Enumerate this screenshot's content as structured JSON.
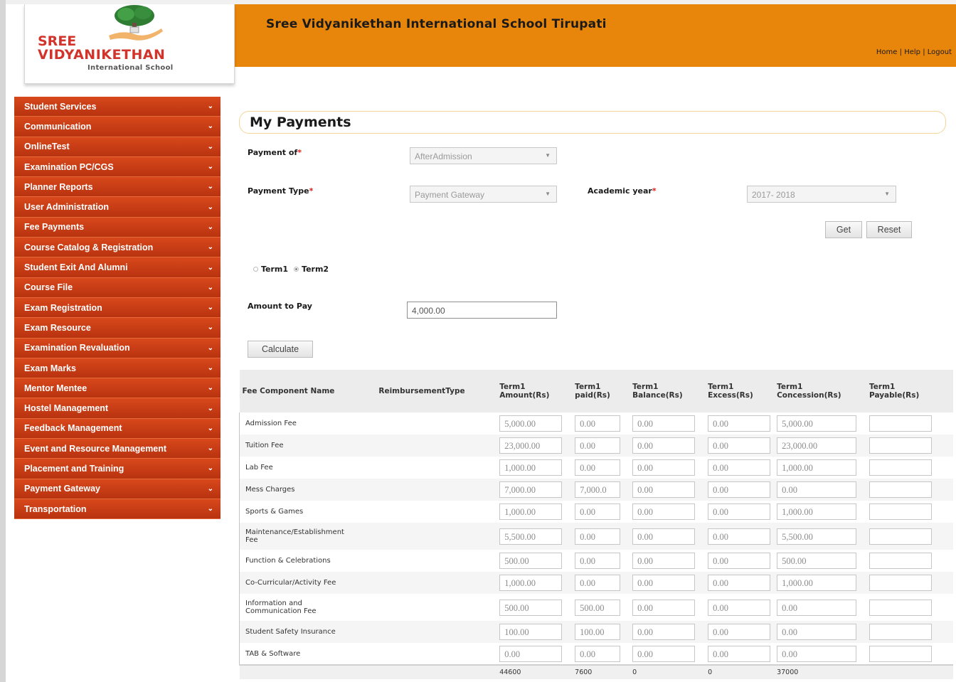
{
  "header": {
    "site_title": "Sree Vidyanikethan International School Tirupati",
    "links": [
      "Home",
      "Help",
      "Logout"
    ]
  },
  "logo": {
    "line1": "SREE",
    "line2": "VIDYANIKETHAN",
    "line3": "International School"
  },
  "sidebar": {
    "items": [
      "Student Services",
      "Communication",
      "OnlineTest",
      "Examination PC/CGS",
      "Planner Reports",
      "User Administration",
      "Fee Payments",
      "Course Catalog & Registration",
      "Student Exit And Alumni",
      "Course File",
      "Exam Registration",
      "Exam Resource",
      "Examination Revaluation",
      "Exam Marks",
      "Mentor Mentee",
      "Hostel Management",
      "Feedback Management",
      "Event and Resource Management",
      "Placement and Training",
      "Payment Gateway",
      "Transportation"
    ]
  },
  "page": {
    "title": "My Payments"
  },
  "form": {
    "payment_of_label": "Payment of",
    "payment_of_value": "AfterAdmission",
    "payment_type_label": "Payment Type",
    "payment_type_value": "Payment Gateway",
    "academic_year_label": "Academic year",
    "academic_year_value": "2017- 2018",
    "get_label": "Get",
    "reset_label": "Reset",
    "term1_label": "Term1",
    "term2_label": "Term2",
    "selected_term": "Term2",
    "amount_label": "Amount to Pay",
    "amount_value": "4,000.00",
    "calculate_label": "Calculate",
    "required_mark": "*"
  },
  "table": {
    "headers": [
      [
        "Fee Component Name"
      ],
      [
        "ReimbursementType"
      ],
      [
        "Term1",
        "Amount(Rs)"
      ],
      [
        "Term1",
        "paid(Rs)"
      ],
      [
        "Term1",
        "Balance(Rs)"
      ],
      [
        "Term1",
        "Excess(Rs)"
      ],
      [
        "Term1",
        "Concession(Rs)"
      ],
      [
        "Term1",
        "Payable(Rs)"
      ]
    ],
    "rows": [
      {
        "name": [
          "Admission Fee"
        ],
        "amount": "5,000.00",
        "paid": "0.00",
        "balance": "0.00",
        "excess": "0.00",
        "concession": "5,000.00",
        "payable": ""
      },
      {
        "name": [
          "Tuition Fee"
        ],
        "amount": "23,000.00",
        "paid": "0.00",
        "balance": "0.00",
        "excess": "0.00",
        "concession": "23,000.00",
        "payable": ""
      },
      {
        "name": [
          "Lab Fee"
        ],
        "amount": "1,000.00",
        "paid": "0.00",
        "balance": "0.00",
        "excess": "0.00",
        "concession": "1,000.00",
        "payable": ""
      },
      {
        "name": [
          "Mess Charges"
        ],
        "amount": "7,000.00",
        "paid": "7,000.0",
        "balance": "0.00",
        "excess": "0.00",
        "concession": "0.00",
        "payable": ""
      },
      {
        "name": [
          "Sports & Games"
        ],
        "amount": "1,000.00",
        "paid": "0.00",
        "balance": "0.00",
        "excess": "0.00",
        "concession": "1,000.00",
        "payable": ""
      },
      {
        "name": [
          "Maintenance/Establishment",
          "Fee"
        ],
        "amount": "5,500.00",
        "paid": "0.00",
        "balance": "0.00",
        "excess": "0.00",
        "concession": "5,500.00",
        "payable": ""
      },
      {
        "name": [
          "Function & Celebrations"
        ],
        "amount": "500.00",
        "paid": "0.00",
        "balance": "0.00",
        "excess": "0.00",
        "concession": "500.00",
        "payable": ""
      },
      {
        "name": [
          "Co-Curricular/Activity Fee"
        ],
        "amount": "1,000.00",
        "paid": "0.00",
        "balance": "0.00",
        "excess": "0.00",
        "concession": "1,000.00",
        "payable": ""
      },
      {
        "name": [
          "Information and",
          "Communication Fee"
        ],
        "amount": "500.00",
        "paid": "500.00",
        "balance": "0.00",
        "excess": "0.00",
        "concession": "0.00",
        "payable": ""
      },
      {
        "name": [
          "Student Safety Insurance"
        ],
        "amount": "100.00",
        "paid": "100.00",
        "balance": "0.00",
        "excess": "0.00",
        "concession": "0.00",
        "payable": ""
      },
      {
        "name": [
          "TAB & Software"
        ],
        "amount": "0.00",
        "paid": "0.00",
        "balance": "0.00",
        "excess": "0.00",
        "concession": "0.00",
        "payable": ""
      }
    ],
    "totals": {
      "amount": "44600",
      "paid": "7600",
      "balance": "0",
      "excess": "0",
      "concession": "37000"
    }
  },
  "colors": {
    "header_orange": "#e8860c",
    "menu_red": "#c93c14",
    "logo_red": "#d2342c"
  }
}
